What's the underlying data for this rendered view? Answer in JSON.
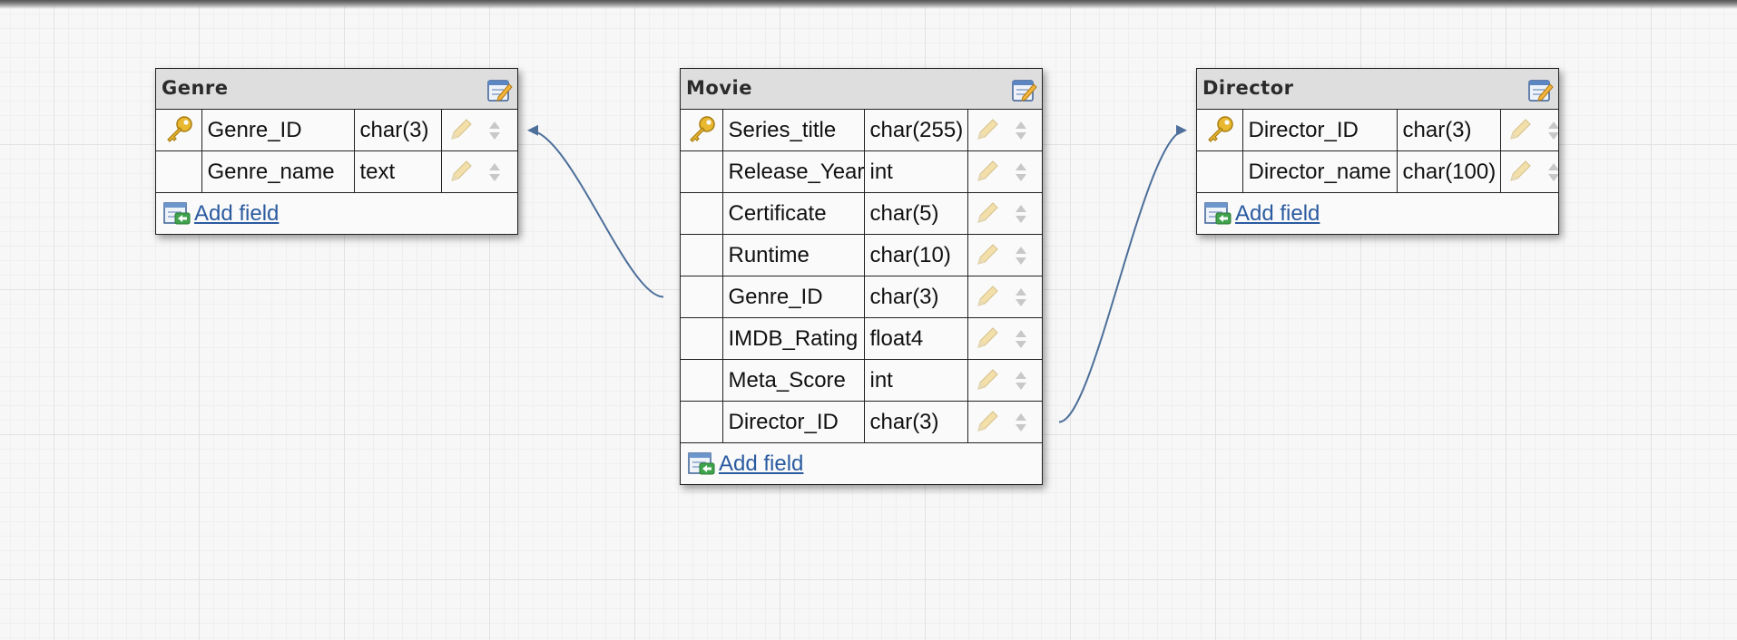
{
  "tables": [
    {
      "name": "Genre",
      "fields": [
        {
          "name": "Genre_ID",
          "type": "char(3)",
          "primary_key": true
        },
        {
          "name": "Genre_name",
          "type": "text",
          "primary_key": false
        }
      ],
      "add_field_label": "Add field"
    },
    {
      "name": "Movie",
      "fields": [
        {
          "name": "Series_title",
          "type": "char(255)",
          "primary_key": true
        },
        {
          "name": "Release_Year",
          "type": "int",
          "primary_key": false
        },
        {
          "name": "Certificate",
          "type": "char(5)",
          "primary_key": false
        },
        {
          "name": "Runtime",
          "type": "char(10)",
          "primary_key": false
        },
        {
          "name": "Genre_ID",
          "type": "char(3)",
          "primary_key": false
        },
        {
          "name": "IMDB_Rating",
          "type": "float4",
          "primary_key": false
        },
        {
          "name": "Meta_Score",
          "type": "int",
          "primary_key": false
        },
        {
          "name": "Director_ID",
          "type": "char(3)",
          "primary_key": false
        }
      ],
      "add_field_label": "Add field"
    },
    {
      "name": "Director",
      "fields": [
        {
          "name": "Director_ID",
          "type": "char(3)",
          "primary_key": true
        },
        {
          "name": "Director_name",
          "type": "char(100)",
          "primary_key": false
        }
      ],
      "add_field_label": "Add field"
    }
  ],
  "relations": [
    {
      "from_table": "Movie",
      "from_field": "Genre_ID",
      "to_table": "Genre",
      "to_field": "Genre_ID"
    },
    {
      "from_table": "Movie",
      "from_field": "Director_ID",
      "to_table": "Director",
      "to_field": "Director_ID"
    }
  ],
  "icons": {
    "primary_key": "key-icon",
    "edit_table": "edit-table-icon",
    "edit_field": "pencil-icon",
    "reorder_field": "reorder-arrows-icon",
    "add_field": "add-field-icon"
  },
  "colors": {
    "link": "#2a5aa0",
    "relation_line": "#4d6f9a",
    "header_bg": "#dedede",
    "key_gold": "#e8b830"
  }
}
